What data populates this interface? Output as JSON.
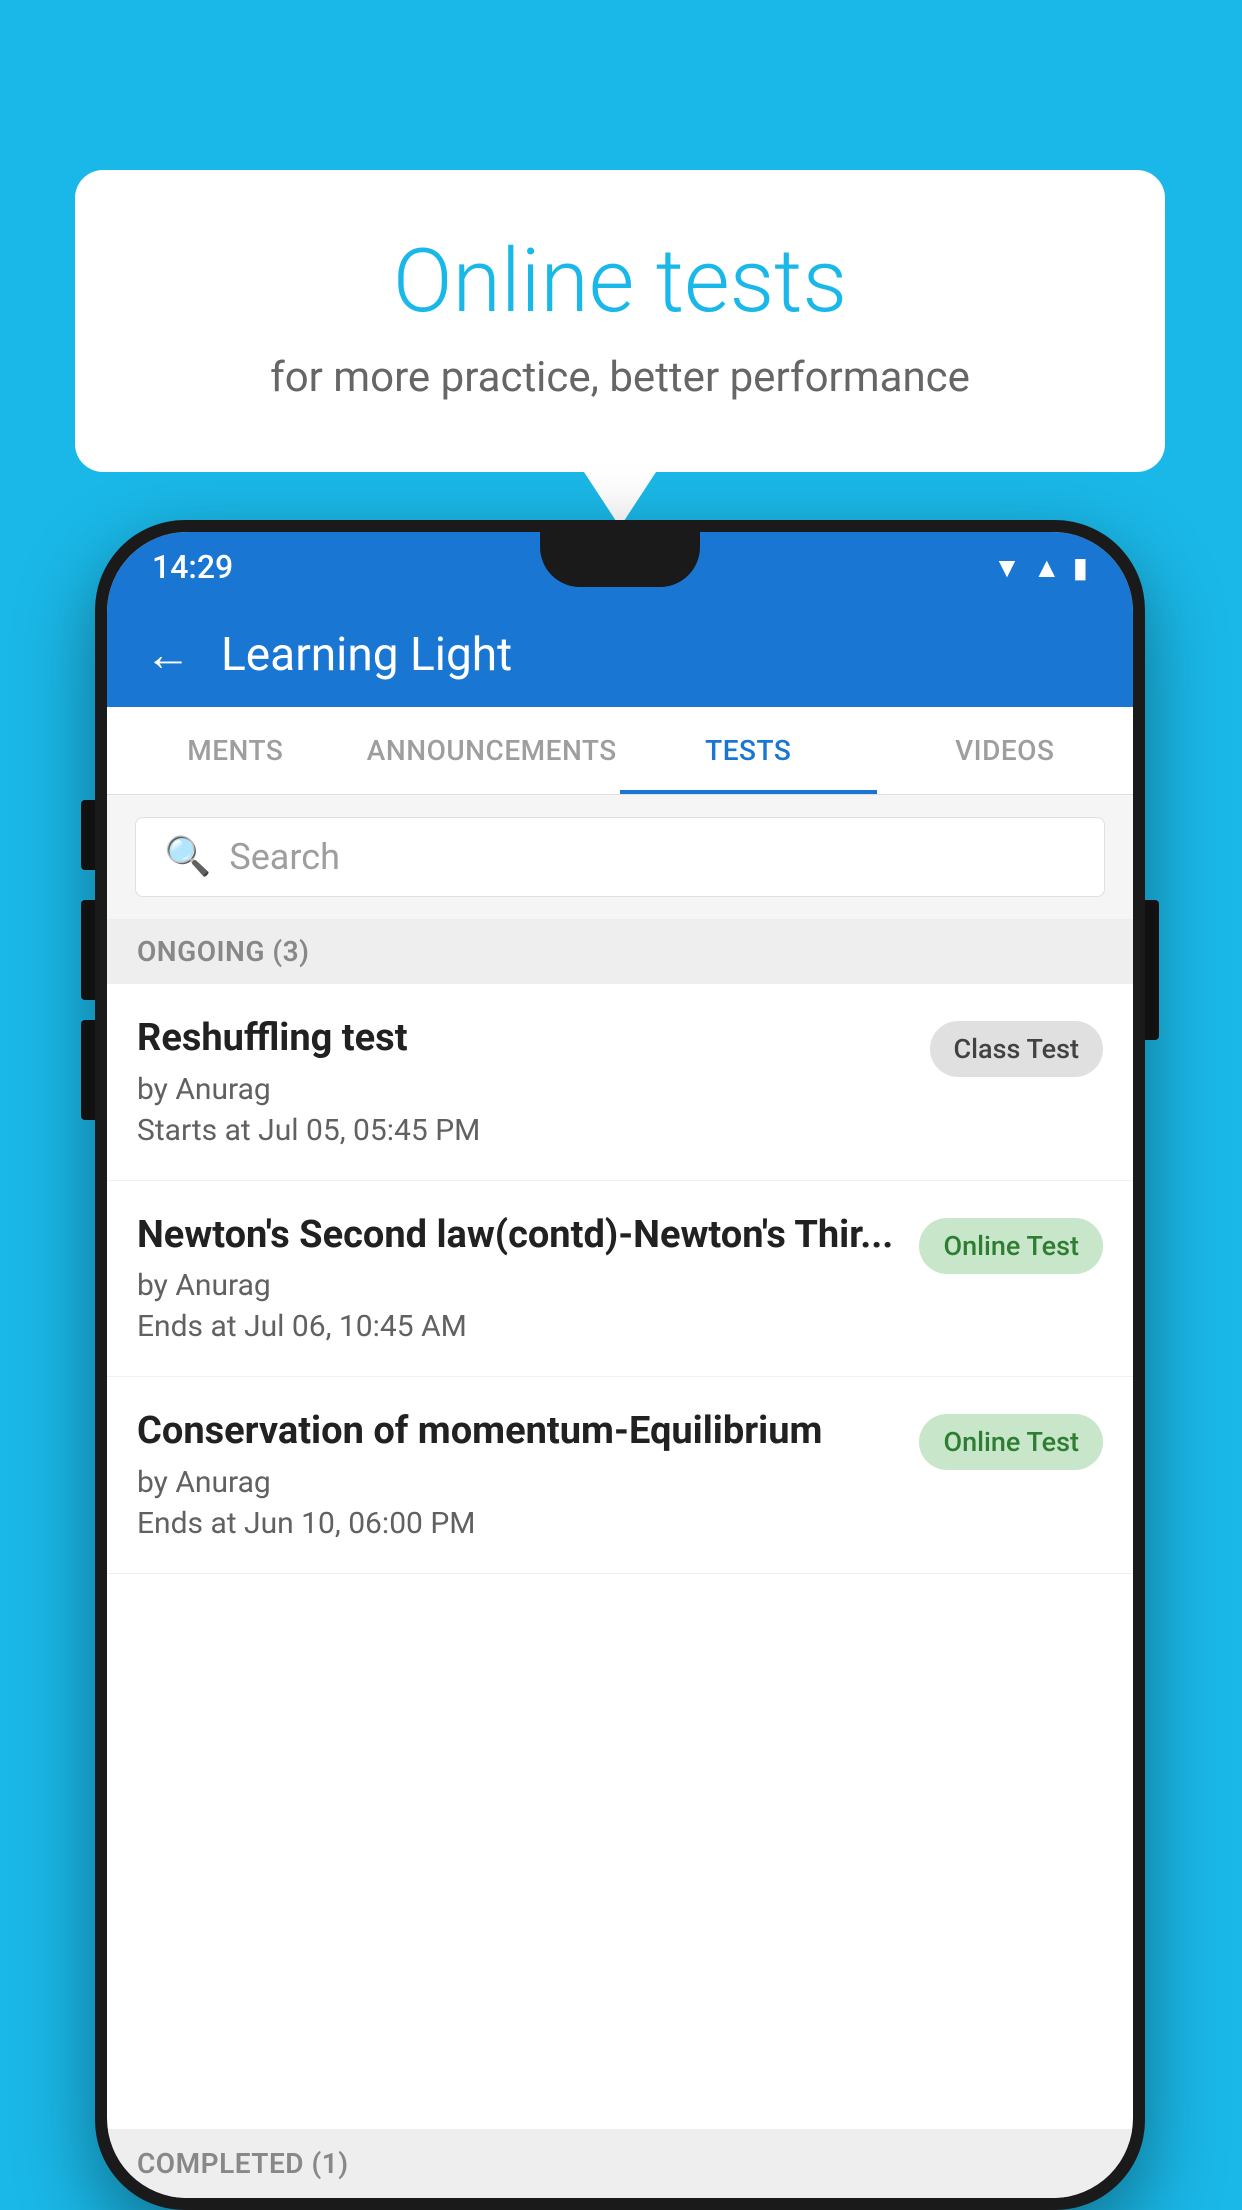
{
  "background_color": "#1ab8e8",
  "speech_bubble": {
    "title": "Online tests",
    "subtitle": "for more practice, better performance"
  },
  "phone": {
    "status_bar": {
      "time": "14:29",
      "icons": [
        "wifi",
        "signal",
        "battery"
      ]
    },
    "app_header": {
      "back_label": "←",
      "title": "Learning Light"
    },
    "tabs": [
      {
        "label": "MENTS",
        "active": false
      },
      {
        "label": "ANNOUNCEMENTS",
        "active": false
      },
      {
        "label": "TESTS",
        "active": true
      },
      {
        "label": "VIDEOS",
        "active": false
      }
    ],
    "search": {
      "placeholder": "Search"
    },
    "sections": [
      {
        "label": "ONGOING (3)",
        "items": [
          {
            "name": "Reshuffling test",
            "author": "by Anurag",
            "date": "Starts at  Jul 05, 05:45 PM",
            "badge": "Class Test",
            "badge_type": "class"
          },
          {
            "name": "Newton's Second law(contd)-Newton's Thir...",
            "author": "by Anurag",
            "date": "Ends at  Jul 06, 10:45 AM",
            "badge": "Online Test",
            "badge_type": "online"
          },
          {
            "name": "Conservation of momentum-Equilibrium",
            "author": "by Anurag",
            "date": "Ends at  Jun 10, 06:00 PM",
            "badge": "Online Test",
            "badge_type": "online"
          }
        ]
      }
    ],
    "completed_section": {
      "label": "COMPLETED (1)"
    }
  }
}
